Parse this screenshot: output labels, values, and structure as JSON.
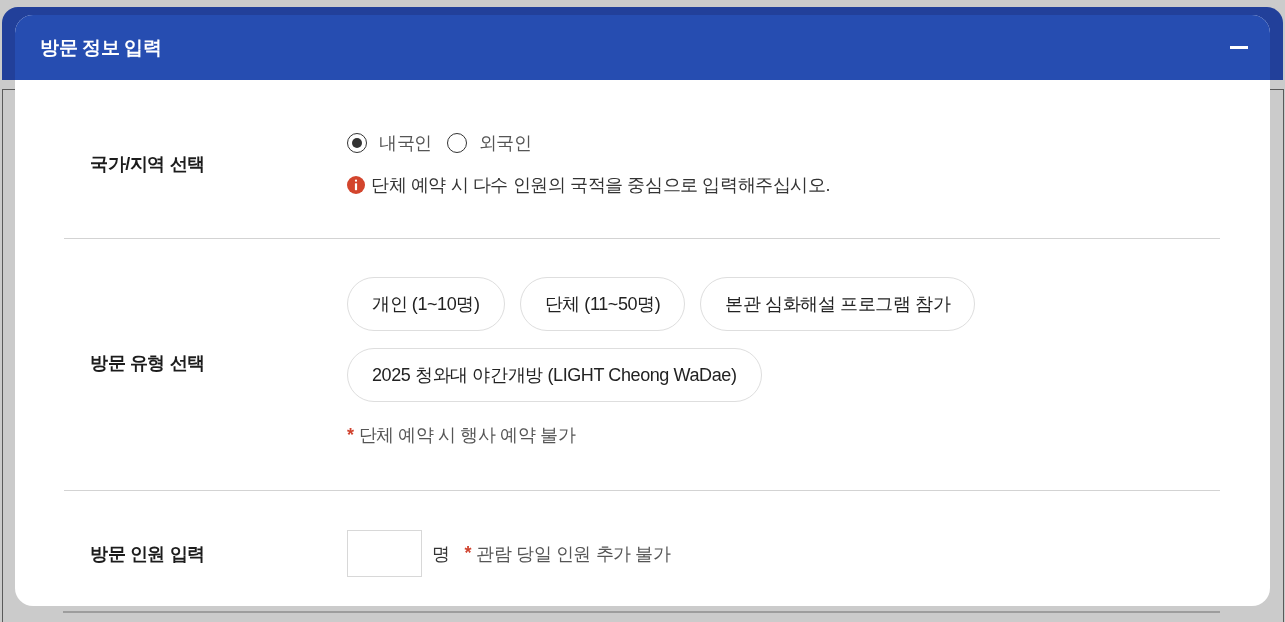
{
  "panel": {
    "title": "방문 정보 입력",
    "expanded": true
  },
  "rows": [
    {
      "kind": "radio",
      "label": "국가/지역 선택",
      "options": [
        {
          "label": "내국인",
          "selected": true
        },
        {
          "label": "외국인",
          "selected": false
        }
      ],
      "info": "단체 예약 시 다수 인원의 국적을 중심으로 입력해주십시오."
    },
    {
      "kind": "chips",
      "label": "방문 유형 선택",
      "options": [
        {
          "label": "개인 (1~10명)",
          "selected": false
        },
        {
          "label": "단체 (11~50명)",
          "selected": false
        },
        {
          "label": "본관 심화해설 프로그램 참가",
          "selected": false
        },
        {
          "label": "2025 청와대 야간개방 (LIGHT Cheong WaDae)",
          "selected": false
        }
      ],
      "note": {
        "mark": "*",
        "text": "단체 예약 시 행사 예약 불가"
      }
    },
    {
      "kind": "count",
      "label": "방문 인원 입력",
      "unit": "명",
      "note": {
        "mark": "*",
        "text": "관람 당일 인원 추가 불가"
      }
    }
  ]
}
